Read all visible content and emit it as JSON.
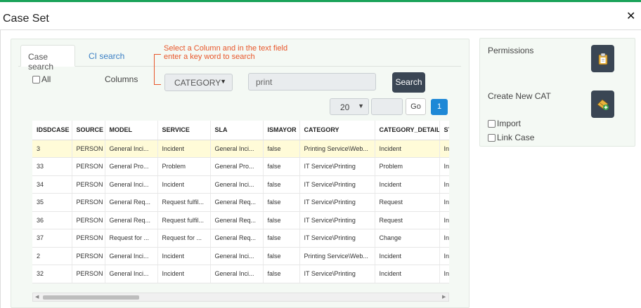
{
  "dialog": {
    "title": "Case Set",
    "close_glyph": "✕"
  },
  "tabs": [
    {
      "label": "Case search",
      "active": true
    },
    {
      "label": "CI search",
      "active": false
    }
  ],
  "annotation": {
    "line1": "Select a Column and in the text field",
    "line2": "enter a key word to search",
    "color": "#e8562a"
  },
  "filters": {
    "all_label": "All",
    "columns_label": "Columns",
    "column_selected": "CATEGORY",
    "keyword_value": "print",
    "search_label": "Search"
  },
  "pagination": {
    "page_size": "20",
    "go_label": "Go",
    "current_page": "1"
  },
  "table": {
    "headers": [
      "IDSDCASE",
      "SOURCE",
      "MODEL",
      "SERVICE",
      "SLA",
      "ISMAYOR",
      "CATEGORY",
      "CATEGORY_DETAIL",
      "ST"
    ],
    "rows": [
      [
        "3",
        "PERSON",
        "General Inci...",
        "Incident",
        "General Inci...",
        "false",
        "Printing Service\\Web...",
        "Incident",
        "In"
      ],
      [
        "33",
        "PERSON",
        "General Pro...",
        "Problem",
        "General Pro...",
        "false",
        "IT Service\\Printing",
        "Problem",
        "In"
      ],
      [
        "34",
        "PERSON",
        "General Inci...",
        "Incident",
        "General Inci...",
        "false",
        "IT Service\\Printing",
        "Incident",
        "In"
      ],
      [
        "35",
        "PERSON",
        "General Req...",
        "Request fulfil...",
        "General Req...",
        "false",
        "IT Service\\Printing",
        "Request",
        "In"
      ],
      [
        "36",
        "PERSON",
        "General Req...",
        "Request fulfil...",
        "General Req...",
        "false",
        "IT Service\\Printing",
        "Request",
        "In"
      ],
      [
        "37",
        "PERSON",
        "Request for ...",
        "Request for ...",
        "General Req...",
        "false",
        "IT Service\\Printing",
        "Change",
        "In"
      ],
      [
        "2",
        "PERSON",
        "General Inci...",
        "Incident",
        "General Inci...",
        "false",
        "Printing Service\\Web...",
        "Incident",
        "In"
      ],
      [
        "32",
        "PERSON",
        "General Inci...",
        "Incident",
        "General Inci...",
        "false",
        "IT Service\\Printing",
        "Incident",
        "In"
      ]
    ],
    "highlighted_row": 0
  },
  "side": {
    "permissions_label": "Permissions",
    "create_label": "Create New CAT",
    "import_label": "Import",
    "link_case_label": "Link Case"
  },
  "colors": {
    "accent_green": "#1aa35a",
    "dark_button": "#3a4654",
    "page_blue": "#1e88d6",
    "highlight_row": "#fffbd8"
  }
}
